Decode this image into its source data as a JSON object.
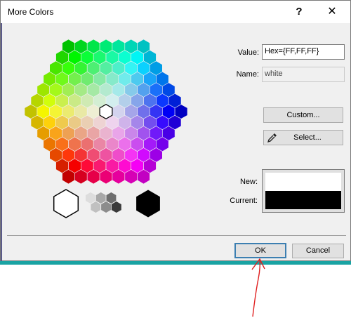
{
  "dialog": {
    "title": "More Colors",
    "help_glyph": "?",
    "close_glyph": "✕"
  },
  "value_label": "Value:",
  "value_field": "Hex={FF,FF,FF}",
  "name_label": "Name:",
  "name_field": "white",
  "custom_button": "Custom...",
  "select_button": "Select...",
  "eyedropper_icon": "eyedropper-icon",
  "new_label": "New:",
  "current_label": "Current:",
  "new_color": "#ffffff",
  "current_color": "#000000",
  "ok_button": "OK",
  "cancel_button": "Cancel",
  "annotation_color": "#e02020",
  "grays": [
    "#ffffff",
    "#dddddd",
    "#c0c0c0",
    "#a8a8a8",
    "#8c8c8c",
    "#6e6e6e",
    "#555555",
    "#3a3a3a",
    "#000000"
  ]
}
